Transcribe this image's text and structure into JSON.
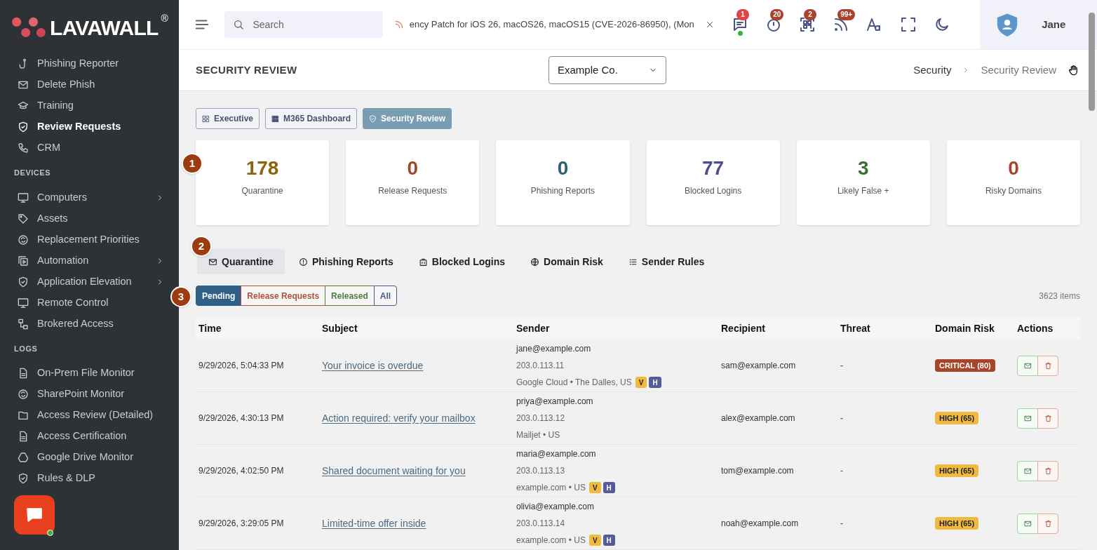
{
  "sidebar": {
    "logo": "LAVAWALL",
    "logo_mark": "®",
    "sections": [
      {
        "items": [
          {
            "label": "Phishing Reporter",
            "selected": false,
            "expandable": false
          },
          {
            "label": "Delete Phish",
            "selected": false,
            "expandable": false
          },
          {
            "label": "Training",
            "selected": false,
            "expandable": false
          },
          {
            "label": "Review Requests",
            "selected": true,
            "expandable": false
          },
          {
            "label": "CRM",
            "selected": false,
            "expandable": false
          }
        ]
      },
      {
        "title": "DEVICES",
        "items": [
          {
            "label": "Computers",
            "selected": false,
            "expandable": true
          },
          {
            "label": "Assets",
            "selected": false,
            "expandable": false
          },
          {
            "label": "Replacement Priorities",
            "selected": false,
            "expandable": false
          },
          {
            "label": "Automation",
            "selected": false,
            "expandable": true
          },
          {
            "label": "Application Elevation",
            "selected": false,
            "expandable": true
          },
          {
            "label": "Remote Control",
            "selected": false,
            "expandable": false
          },
          {
            "label": "Brokered Access",
            "selected": false,
            "expandable": false
          }
        ]
      },
      {
        "title": "LOGS",
        "items": [
          {
            "label": "On-Prem File Monitor",
            "selected": false,
            "expandable": false
          },
          {
            "label": "SharePoint Monitor",
            "selected": false,
            "expandable": false
          },
          {
            "label": "Access Review (Detailed)",
            "selected": false,
            "expandable": false
          },
          {
            "label": "Access Certification",
            "selected": false,
            "expandable": false
          },
          {
            "label": "Google Drive Monitor",
            "selected": false,
            "expandable": false
          },
          {
            "label": "Rules & DLP",
            "selected": false,
            "expandable": false
          }
        ]
      }
    ]
  },
  "header": {
    "search": {
      "placeholder": "Search"
    },
    "ticker": "ency Patch for iOS 26, macOS26, macOS15 (CVE-2026-86950), (Mon",
    "icons": [
      {
        "kind": "chat",
        "badge": "1",
        "color": "#e04545",
        "online": true
      },
      {
        "kind": "timer",
        "badge": "20",
        "color": "#a8432c",
        "online": false
      },
      {
        "kind": "qr",
        "badge": "2",
        "color": "#a8432c",
        "online": false
      },
      {
        "kind": "rss",
        "badge": "99+",
        "color": "#a8432c",
        "online": false
      },
      {
        "kind": "font"
      },
      {
        "kind": "fullscreen"
      },
      {
        "kind": "moon"
      }
    ],
    "user": "Jane"
  },
  "page": {
    "title": "SECURITY REVIEW",
    "company": "Example Co.",
    "breadcrumb": [
      "Security",
      "Security Review"
    ]
  },
  "dashboards": [
    {
      "label": "Executive",
      "selected": false
    },
    {
      "label": "M365 Dashboard",
      "selected": false
    },
    {
      "label": "Security Review",
      "selected": true
    }
  ],
  "markers": [
    "1",
    "2",
    "3"
  ],
  "stats": [
    {
      "value": "178",
      "label": "Quarantine",
      "color": "#8a6510"
    },
    {
      "value": "0",
      "label": "Release Requests",
      "color": "#a3462b"
    },
    {
      "value": "0",
      "label": "Phishing Reports",
      "color": "#2d6170"
    },
    {
      "value": "77",
      "label": "Blocked Logins",
      "color": "#4b4f8c"
    },
    {
      "value": "3",
      "label": "Likely False +",
      "color": "#3a6e33"
    },
    {
      "value": "0",
      "label": "Risky Domains",
      "color": "#a3462b"
    }
  ],
  "tabs": [
    {
      "label": "Quarantine",
      "selected": true
    },
    {
      "label": "Phishing Reports",
      "selected": false
    },
    {
      "label": "Blocked Logins",
      "selected": false
    },
    {
      "label": "Domain Risk",
      "selected": false
    },
    {
      "label": "Sender Rules",
      "selected": false
    }
  ],
  "filters": [
    {
      "label": "Pending",
      "color": "#2f5f88",
      "selected": true
    },
    {
      "label": "Release Requests",
      "color": "#b0523a",
      "selected": false
    },
    {
      "label": "Released",
      "color": "#4f7d3e",
      "selected": false
    },
    {
      "label": "All",
      "color": "#4a5a8a",
      "selected": false
    }
  ],
  "item_count": "3623 items",
  "table": {
    "columns": [
      "Time",
      "Subject",
      "Sender",
      "Recipient",
      "Threat",
      "Domain Risk",
      "Actions"
    ],
    "rows": [
      {
        "time": "9/29/2026, 5:04:33 PM",
        "subject": "Your invoice is overdue",
        "sender": "jane@example.com",
        "ip": "203.0.113.11",
        "origin": "Google Cloud • The Dalles, US",
        "flags": [
          {
            "text": "V",
            "kind": "v"
          },
          {
            "text": "H",
            "kind": "h"
          }
        ],
        "recipient": "sam@example.com",
        "threat": "-",
        "risk": {
          "text": "CRITICAL (80)",
          "kind": "critical"
        }
      },
      {
        "time": "9/29/2026, 4:30:13 PM",
        "subject": "Action required: verify your mailbox",
        "sender": "priya@example.com",
        "ip": "203.0.113.12",
        "origin": "Mailjet • US",
        "recipient": "alex@example.com",
        "threat": "-",
        "risk": {
          "text": "HIGH (65)",
          "kind": "high"
        }
      },
      {
        "time": "9/29/2026, 4:02:50 PM",
        "subject": "Shared document waiting for you",
        "sender": "maria@example.com",
        "ip": "203.0.113.13",
        "origin": "example.com • US",
        "flags": [
          {
            "text": "V",
            "kind": "v"
          },
          {
            "text": "H",
            "kind": "h"
          }
        ],
        "recipient": "tom@example.com",
        "threat": "-",
        "risk": {
          "text": "HIGH (65)",
          "kind": "high"
        }
      },
      {
        "time": "9/29/2026, 3:29:05 PM",
        "subject": "Limited-time offer inside",
        "sender": "olivia@example.com",
        "ip": "203.0.113.14",
        "origin": "example.com • US",
        "flags": [
          {
            "text": "V",
            "kind": "v"
          },
          {
            "text": "H",
            "kind": "h"
          }
        ],
        "recipient": "noah@example.com",
        "threat": "-",
        "risk": {
          "text": "HIGH (65)",
          "kind": "high"
        }
      }
    ]
  }
}
